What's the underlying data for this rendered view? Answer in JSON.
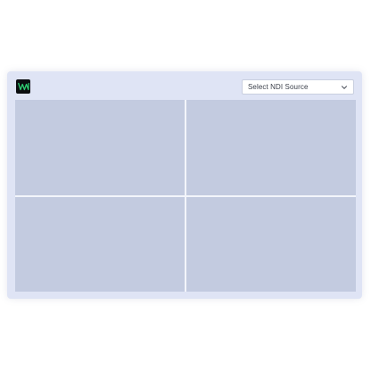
{
  "app": {
    "logo_text": "VW",
    "logo_color": "#2ecc71",
    "logo_bg": "#0b0d10"
  },
  "source_select": {
    "selected_label": "Select NDI Source"
  },
  "video_grid": {
    "tiles": [
      "tile-1",
      "tile-2",
      "tile-3",
      "tile-4"
    ],
    "tile_color": "#c3cbe0"
  }
}
